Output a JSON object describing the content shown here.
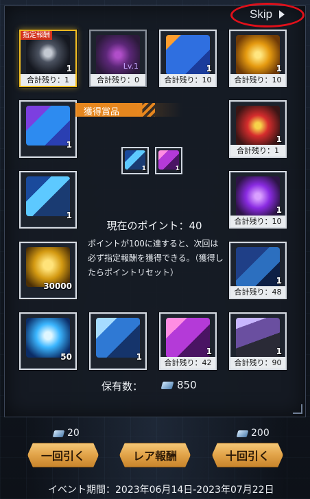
{
  "skip_label": "Skip",
  "banner_label": "獲得賞品",
  "tiles": [
    {
      "tag": "指定報酬",
      "qty": "1",
      "remain": "合計残り：1"
    },
    {
      "lvl": "Lv.1",
      "remain": "合計残り：0"
    },
    {
      "qty": "1",
      "remain": "合計残り：10"
    },
    {
      "qty": "1",
      "remain": "合計残り：10"
    },
    {
      "qty": "1"
    },
    {
      "qty": "1",
      "remain": "合計残り：1"
    },
    {
      "qty": "1"
    },
    {
      "qty": "1",
      "remain": "合計残り：10"
    },
    {
      "qty": "30000"
    },
    {
      "qty": "1",
      "remain": "合計残り：48"
    },
    {
      "qty": "50"
    },
    {
      "qty": "1"
    },
    {
      "qty": "1",
      "remain": "合計残り：42"
    },
    {
      "qty": "1",
      "remain": "合計残り：90"
    }
  ],
  "obtained": [
    {
      "qty": "1",
      "icon": "tube-icon"
    },
    {
      "qty": "1",
      "icon": "gift-icon"
    }
  ],
  "points_text": "現在のポイント：40",
  "points_desc": "ポイントが100に達すると、次回は必ず指定報酬を獲得できる。（獲得したらポイントリセット）",
  "owned_label": "保有数：",
  "owned_value": "850",
  "cost_single": "20",
  "cost_ten": "200",
  "buttons": {
    "single": "一回引く",
    "rare": "レア報酬",
    "ten": "十回引く"
  },
  "event_period": "イベント期間：2023年06月14日-2023年07月22日",
  "colors": {
    "accent": "#e1a348",
    "highlight": "#f5c022",
    "skip_circle": "#e0101a"
  }
}
